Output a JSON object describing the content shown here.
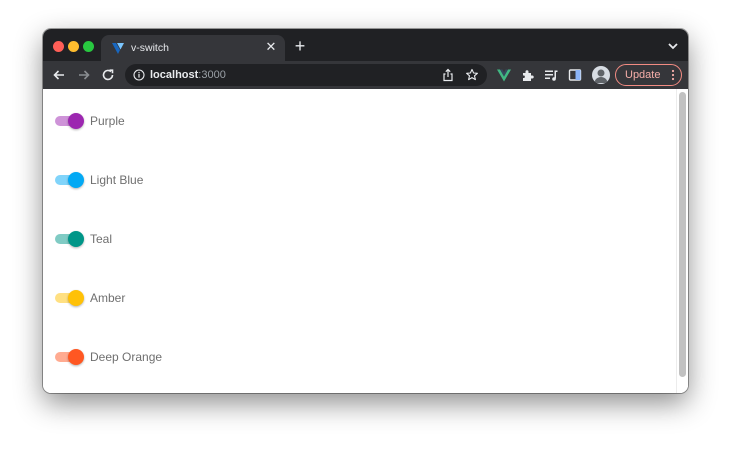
{
  "browser": {
    "tab_title": "v-switch",
    "url_host": "localhost",
    "url_port": ":3000",
    "update_label": "Update"
  },
  "icons": {
    "favicon": "vuetify-logo-icon",
    "close": "close-icon",
    "new_tab": "plus-icon",
    "tab_search": "chevron-down-icon",
    "back": "arrow-left-icon",
    "forward": "arrow-right-icon",
    "reload": "reload-icon",
    "site_info": "info-icon",
    "share": "share-icon",
    "bookmark": "star-icon",
    "vue_devtools": "vue-logo-icon",
    "extensions": "puzzle-icon",
    "reading_list": "queue-music-icon",
    "side_panel": "side-panel-icon",
    "profile": "avatar-icon",
    "menu": "more-vert-icon"
  },
  "switches": [
    {
      "label": "Purple",
      "color": "#9c27b0",
      "track_color": "#ce93d8",
      "on": true
    },
    {
      "label": "Light Blue",
      "color": "#03a9f4",
      "track_color": "#81d4fa",
      "on": true
    },
    {
      "label": "Teal",
      "color": "#009688",
      "track_color": "#80cbc4",
      "on": true
    },
    {
      "label": "Amber",
      "color": "#ffc107",
      "track_color": "#ffe082",
      "on": true
    },
    {
      "label": "Deep Orange",
      "color": "#ff5722",
      "track_color": "#ffab91",
      "on": true
    }
  ]
}
